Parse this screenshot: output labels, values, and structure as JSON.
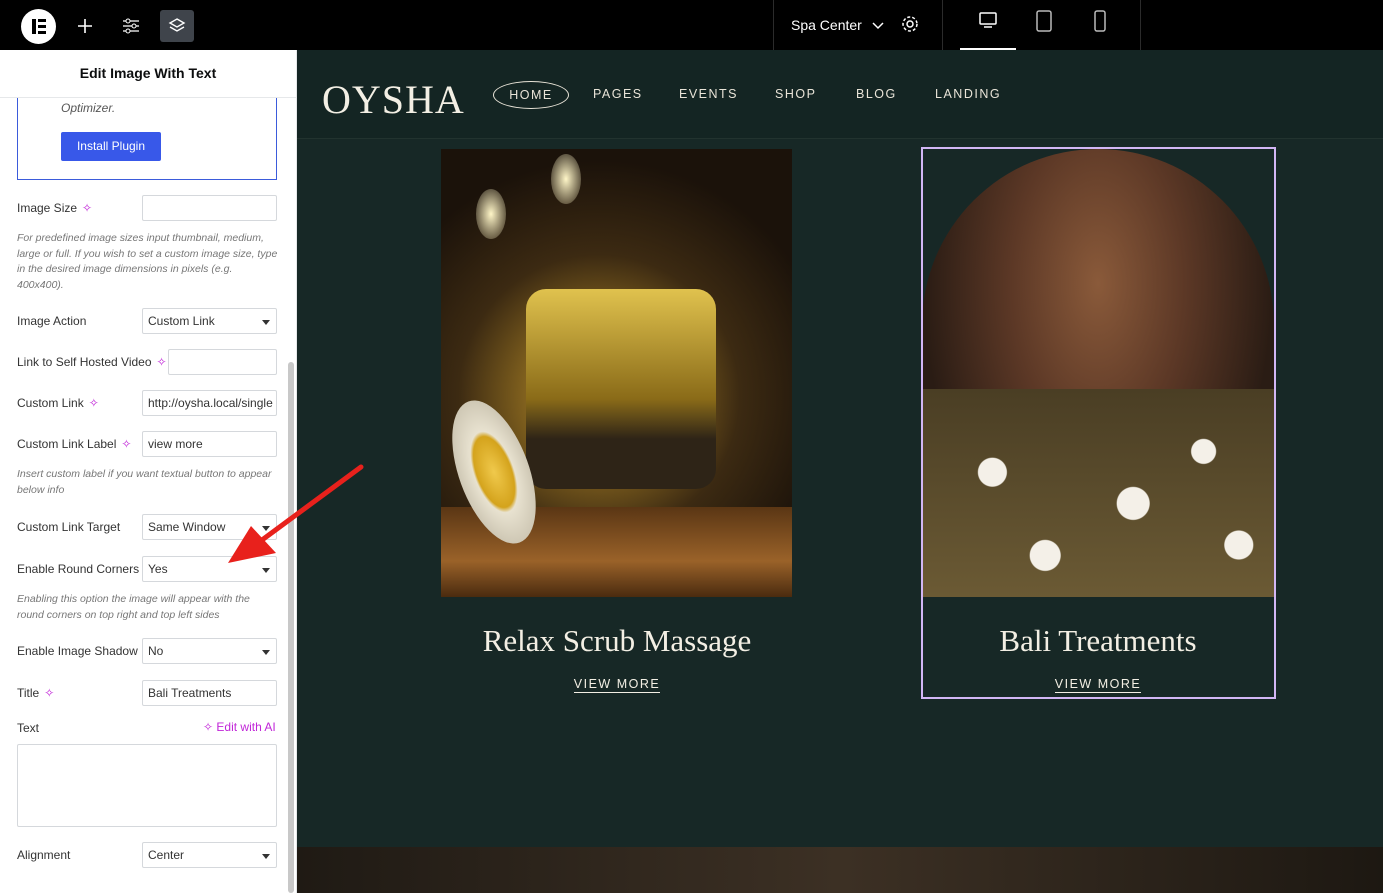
{
  "topbar": {
    "site_selector": "Spa Center"
  },
  "panel": {
    "title": "Edit Image With Text",
    "notice_text": "Optimizer.",
    "install_button": "Install Plugin",
    "fields": {
      "image_size": {
        "label": "Image Size",
        "value": ""
      },
      "image_size_help": "For predefined image sizes input thumbnail, medium, large or full. If you wish to set a custom image size, type in the desired image dimensions in pixels (e.g. 400x400).",
      "image_action": {
        "label": "Image Action",
        "value": "Custom Link"
      },
      "video_link": {
        "label": "Link to Self Hosted Video",
        "value": ""
      },
      "custom_link": {
        "label": "Custom Link",
        "value": "http://oysha.local/single"
      },
      "custom_link_label": {
        "label": "Custom Link Label",
        "value": "view more"
      },
      "custom_link_label_help": "Insert custom label if you want textual button to appear below info",
      "custom_link_target": {
        "label": "Custom Link Target",
        "value": "Same Window"
      },
      "round_corners": {
        "label": "Enable Round Corners",
        "value": "Yes"
      },
      "round_corners_help": "Enabling this option the image will appear with the round corners on top right and top left sides",
      "image_shadow": {
        "label": "Enable Image Shadow",
        "value": "No"
      },
      "title": {
        "label": "Title",
        "value": "Bali Treatments"
      },
      "text": {
        "label": "Text",
        "value": ""
      },
      "edit_with_ai": "Edit with AI",
      "alignment": {
        "label": "Alignment",
        "value": "Center"
      }
    }
  },
  "preview": {
    "brand": "OYSHA",
    "nav": [
      "HOME",
      "PAGES",
      "EVENTS",
      "SHOP",
      "BLOG",
      "LANDING"
    ],
    "cards": [
      {
        "title": "Relax Scrub Massage",
        "link": "VIEW MORE"
      },
      {
        "title": "Bali Treatments",
        "link": "VIEW MORE"
      }
    ]
  },
  "colors": {
    "site_bg": "#172826",
    "accent": "#3858e9",
    "ai": "#c126d8",
    "selection_outline": "#d2b6f5",
    "annotation_arrow": "#e8211c"
  }
}
